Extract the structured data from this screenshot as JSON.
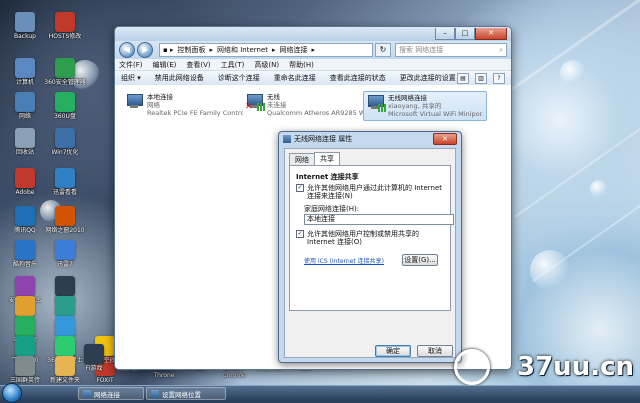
{
  "desktop": {
    "icons": [
      {
        "label": "Backup",
        "color": "#6a8fb8"
      },
      {
        "label": "HOSTS修改",
        "color": "#c0392b"
      },
      {
        "label": "计算机",
        "color": "#5b88c2"
      },
      {
        "label": "360安全管理器",
        "color": "#2e9d4e"
      },
      {
        "label": "网络",
        "color": "#4a7fb5"
      },
      {
        "label": "360U盘",
        "color": "#27ae60"
      },
      {
        "label": "回收站",
        "color": "#8aa0b4"
      },
      {
        "label": "Win7优化",
        "color": "#3c6ea8"
      },
      {
        "label": "Adobe",
        "color": "#c0392b"
      },
      {
        "label": "迅雷看看",
        "color": "#2f80c4"
      },
      {
        "label": "腾讯QQ",
        "color": "#1f6fb5"
      },
      {
        "label": "网络之窗2010",
        "color": "#d35400"
      },
      {
        "label": "酷狗音乐",
        "color": "#2a74c7"
      },
      {
        "label": "迅雷7",
        "color": "#3b7dd8"
      },
      {
        "label": "安乐网吧CS",
        "color": "#8e44ad"
      },
      {
        "label": "腾讯CS",
        "color": "#2c3e50"
      },
      {
        "label": "开心网",
        "color": "#e0a030"
      },
      {
        "label": "网页",
        "color": "#2a9d8f"
      },
      {
        "label": "电脑管家",
        "color": "#27ae60"
      },
      {
        "label": "PPTV",
        "color": "#3498db"
      },
      {
        "label": "飞信2010",
        "color": "#16a085"
      },
      {
        "label": "360安全卫士",
        "color": "#2ecc71"
      },
      {
        "label": "三国群英传",
        "color": "#7f8c8d"
      },
      {
        "label": "新建文件夹",
        "color": "#e6b450"
      },
      {
        "label": "FOXIT",
        "color": "#c0392b"
      },
      {
        "label": "QQ空间",
        "color": "#f1c40f"
      }
    ],
    "bottom_icons": [
      {
        "label": "Fi游戏",
        "color": "#2c3e50"
      },
      {
        "label": "播放器",
        "color": "#34495e"
      },
      {
        "label": "Frozen Throne",
        "color": "#5d6d7e"
      },
      {
        "label": "VLC",
        "color": "#e67e22"
      },
      {
        "label": "Google Chrome",
        "color": "#d4a017"
      },
      {
        "label": "快捷方式",
        "color": "#e6b450"
      },
      {
        "label": "Player",
        "color": "#7f8c8d"
      }
    ]
  },
  "explorer": {
    "breadcrumb": [
      "控制面板",
      "网络和 Internet",
      "网络连接"
    ],
    "search_placeholder": "搜索 网络连接",
    "menu": [
      "文件(F)",
      "编辑(E)",
      "查看(V)",
      "工具(T)",
      "高级(N)",
      "帮助(H)"
    ],
    "commands": [
      "组织 ▾",
      "禁用此网络设备",
      "诊断这个连接",
      "重命名此连接",
      "查看此连接的状态",
      "更改此连接的设置"
    ],
    "connections": [
      {
        "name": "本地连接",
        "status": "网络",
        "device": "Realtek PCIe FE Family Controller"
      },
      {
        "name": "无线",
        "status": "未连接",
        "device": "Qualcomm Atheros AR9285 W..."
      },
      {
        "name": "无线网络连接",
        "status": "xiaoyang, 共享的",
        "device": "Microsoft Virtual WiFi Minipor..."
      }
    ]
  },
  "dialog": {
    "title": "无线网络连接 属性",
    "close": "✕",
    "tabs": [
      "网络",
      "共享"
    ],
    "group_title": "Internet 连接共享",
    "allow_share": "允许其他网络用户通过此计算机的 Internet 连接来连接(N)",
    "allow_share_checked": true,
    "home_network_label": "家庭网络连接(H):",
    "home_network_value": "本地连接",
    "allow_control": "允许其他网络用户控制或禁用共享的 Internet 连接(O)",
    "allow_control_checked": true,
    "ics_link": "使用 ICS (Internet 连接共享)",
    "settings_button": "设置(G)...",
    "ok": "确定",
    "cancel": "取消"
  },
  "taskbar": {
    "tasks": [
      "网络连接",
      "设置网络位置"
    ]
  },
  "watermark": "37uu.cn"
}
